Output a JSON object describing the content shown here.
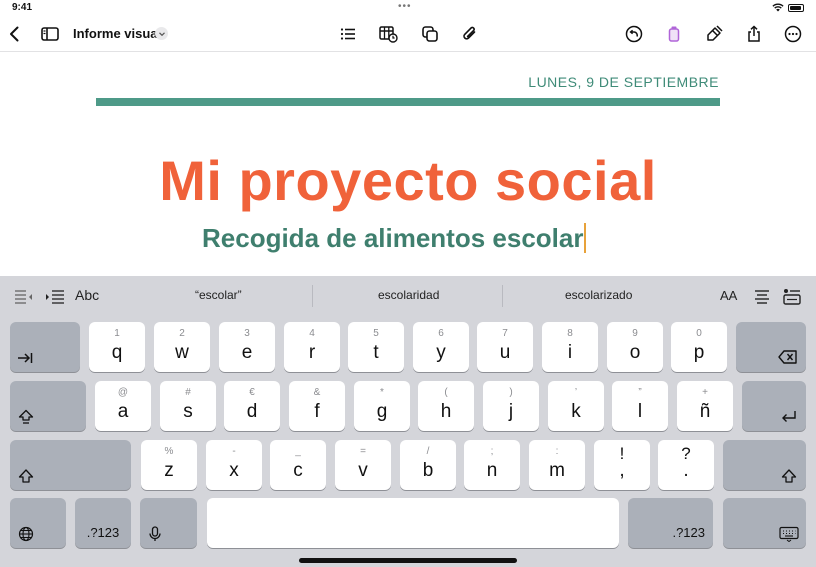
{
  "status": {
    "time": "9:41",
    "dots": "•••"
  },
  "toolbar": {
    "doc_title": "Informe visual",
    "icons": [
      "chevron-left-icon",
      "sidebar-icon",
      "chevron-down-icon",
      "list-icon",
      "table-icon",
      "shapes-icon",
      "paperclip-icon",
      "undo-icon",
      "format-icon",
      "pen-icon",
      "share-icon",
      "more-icon"
    ]
  },
  "document": {
    "date": "LUNES, 9 DE SEPTIEMBRE",
    "heading": "Mi proyecto social",
    "subheading": "Recogida de alimentos escolar",
    "colors": {
      "heading": "#f0623a",
      "subheading": "#3f7f6e",
      "rule": "#4e9a88"
    }
  },
  "keyboard": {
    "suggestions": [
      "“escolar”",
      "escolaridad",
      "escolarizado"
    ],
    "abc_label": "Abc",
    "aa_label": "AA",
    "row1": [
      {
        "p": "q",
        "s": "1"
      },
      {
        "p": "w",
        "s": "2"
      },
      {
        "p": "e",
        "s": "3"
      },
      {
        "p": "r",
        "s": "4"
      },
      {
        "p": "t",
        "s": "5"
      },
      {
        "p": "y",
        "s": "6"
      },
      {
        "p": "u",
        "s": "7"
      },
      {
        "p": "i",
        "s": "8"
      },
      {
        "p": "o",
        "s": "9"
      },
      {
        "p": "p",
        "s": "0"
      }
    ],
    "row2": [
      {
        "p": "a",
        "s": "@"
      },
      {
        "p": "s",
        "s": "#"
      },
      {
        "p": "d",
        "s": "€"
      },
      {
        "p": "f",
        "s": "&"
      },
      {
        "p": "g",
        "s": "*"
      },
      {
        "p": "h",
        "s": "("
      },
      {
        "p": "j",
        "s": ")"
      },
      {
        "p": "k",
        "s": "’"
      },
      {
        "p": "l",
        "s": "”"
      },
      {
        "p": "ñ",
        "s": "+"
      }
    ],
    "row3": [
      {
        "p": "z",
        "s": "%"
      },
      {
        "p": "x",
        "s": "-"
      },
      {
        "p": "c",
        "s": "_"
      },
      {
        "p": "v",
        "s": "="
      },
      {
        "p": "b",
        "s": "/"
      },
      {
        "p": "n",
        "s": ";"
      },
      {
        "p": "m",
        "s": ":"
      },
      {
        "p": ",",
        "s": "!"
      },
      {
        "p": ".",
        "s": "?"
      }
    ],
    "numbers_label": ".?123"
  }
}
